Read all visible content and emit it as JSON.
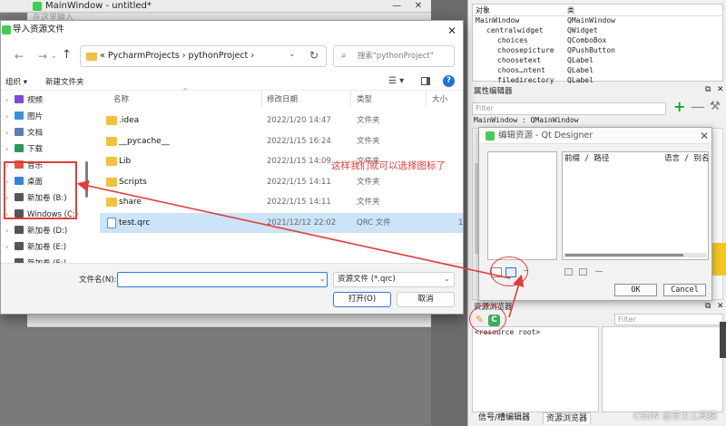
{
  "colors": {
    "annotation_red": "#e23b3b",
    "selection_blue": "#cce4f7",
    "qt_green": "#41cd52",
    "folder_yellow": "#f3c13a"
  },
  "background_window": {
    "title": "MainWindow - untitled*",
    "input_hint": "在这里输入",
    "min_label": "—",
    "close_label": "✕"
  },
  "object_inspector": {
    "header_object": "对象",
    "header_class": "类",
    "rows": [
      {
        "name": "MainWindow",
        "class": "QMainWindow",
        "prefix": "▾ "
      },
      {
        "name": "centralwidget",
        "class": "QWidget",
        "prefix": "▾ "
      },
      {
        "name": "choices",
        "class": "QComboBox",
        "prefix": ""
      },
      {
        "name": "choosepicture",
        "class": "QPushButton",
        "prefix": ""
      },
      {
        "name": "choosetext",
        "class": "QLabel",
        "prefix": ""
      },
      {
        "name": "choos…ntent",
        "class": "QLabel",
        "prefix": ""
      },
      {
        "name": "filedirectory",
        "class": "QLabel",
        "prefix": ""
      }
    ]
  },
  "property_editor": {
    "title": "属性编辑器",
    "float_label": "⧉",
    "close_label": "✕",
    "filter_placeholder": "Filter",
    "plus_label": "+",
    "minus_label": "—",
    "wrench_label": "⚒",
    "class_line": "MainWindow : QMainWindow"
  },
  "resource_browser": {
    "title": "资源浏览器",
    "float_label": "⧉",
    "close_label": "✕",
    "pencil_label": "✎",
    "reload_label": "C",
    "filter_placeholder": "Filter",
    "root_item": "<resource root>",
    "tab_signal": "信号/槽编辑器",
    "tab_resource": "资源浏览器"
  },
  "qt_dialog": {
    "title": "编辑资源 - Qt Designer",
    "close_label": "✕",
    "col_prefix": "前缀 / 路径",
    "col_lang": "语言 / 别名",
    "ok_label": "OK",
    "cancel_label": "Cancel"
  },
  "file_dialog": {
    "title": "导入资源文件",
    "close_label": "✕",
    "back_label": "←",
    "forward_label": "→",
    "recent_label": "⌄",
    "up_label": "↑",
    "address": "« PycharmProjects › pythonProject ›",
    "address_dropdown": "⌄",
    "refresh_label": "↻",
    "search_icon": "⌕",
    "search_placeholder": "搜索\"pythonProject\"",
    "organize_label": "组织 ▾",
    "new_folder_label": "新建文件夹",
    "view_menu_label": "☰ ▾",
    "help_label": "?",
    "nav_items": [
      {
        "label": "视频",
        "chevron": "›",
        "color": "#7b4bd6"
      },
      {
        "label": "图片",
        "chevron": "›",
        "color": "#3d8fd6"
      },
      {
        "label": "文档",
        "chevron": "›",
        "color": "#5a7fb5"
      },
      {
        "label": "下载",
        "chevron": "›",
        "color": "#2a9a57"
      },
      {
        "label": "音乐",
        "chevron": "›",
        "color": "#e2553b"
      },
      {
        "label": "桌面",
        "chevron": "›",
        "color": "#2f86d8"
      },
      {
        "label": "新加卷 (B:)",
        "chevron": "›",
        "color": "#555555"
      },
      {
        "label": "Windows (C:)",
        "chevron": "›",
        "color": "#555555"
      },
      {
        "label": "新加卷 (D:)",
        "chevron": "›",
        "color": "#555555"
      },
      {
        "label": "新加卷 (E:)",
        "chevron": "›",
        "color": "#555555"
      },
      {
        "label": "新加卷 (E:)",
        "chevron": "⌄",
        "color": "#555555"
      }
    ],
    "columns": {
      "name": "名称",
      "date": "修改日期",
      "type": "类型",
      "size": "大小"
    },
    "sort_indicator": "^",
    "files": [
      {
        "name": ".idea",
        "date": "2022/1/20 14:47",
        "type": "文件夹",
        "size": "",
        "kind": "folder"
      },
      {
        "name": "__pycache__",
        "date": "2022/1/15 16:24",
        "type": "文件夹",
        "size": "",
        "kind": "folder"
      },
      {
        "name": "Lib",
        "date": "2022/1/15 14:09",
        "type": "文件夹",
        "size": "",
        "kind": "folder"
      },
      {
        "name": "Scripts",
        "date": "2022/1/15 14:11",
        "type": "文件夹",
        "size": "",
        "kind": "folder"
      },
      {
        "name": "share",
        "date": "2022/1/15 14:11",
        "type": "文件夹",
        "size": "",
        "kind": "folder"
      },
      {
        "name": "test.qrc",
        "date": "2021/12/12 22:02",
        "type": "QRC 文件",
        "size": "1",
        "kind": "qrc"
      }
    ],
    "filename_label": "文件名(N):",
    "filename_value": "",
    "filename_dropdown": "⌄",
    "filetype_value": "资源文件 (*.qrc)",
    "filetype_dropdown": "⌄",
    "open_label": "打开(O)",
    "cancel_label": "取消"
  },
  "annotation": {
    "text": "这样我们就可以选择图标了"
  },
  "watermark": "CSDN @芝士工具猿"
}
